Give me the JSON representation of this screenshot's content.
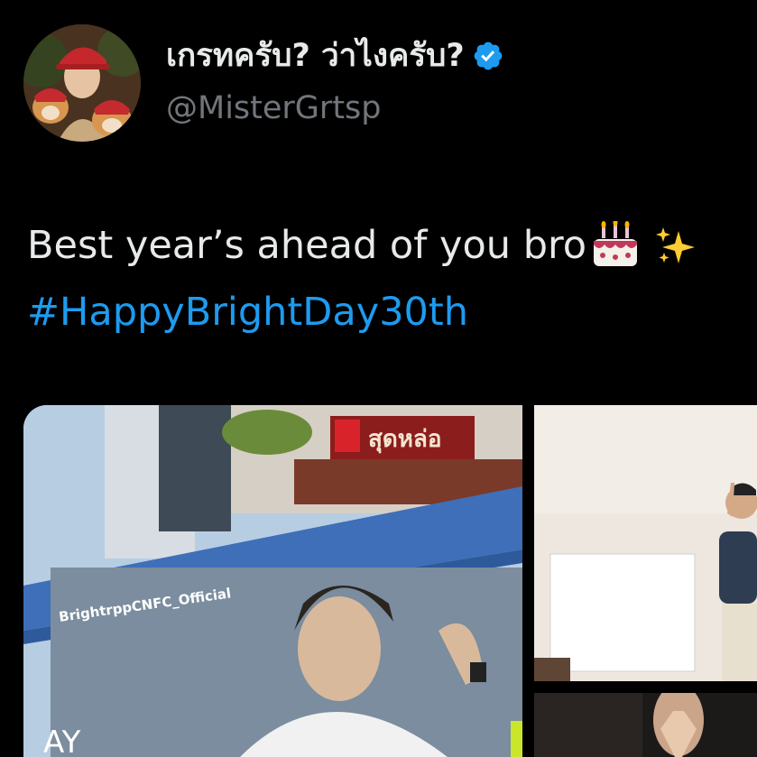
{
  "tweet": {
    "display_name": "เกรทครับ? ว่าไงครับ?",
    "handle": "@MisterGrtsp",
    "text": "Best year’s ahead of you bro",
    "hashtag": "#HappyBrightDay30th"
  },
  "media": {
    "watermark": "BrightrppCNFC_Official",
    "billboard_partial_text": "AY",
    "sign_text": "สุดหล่อ"
  },
  "colors": {
    "background": "#000000",
    "primary_text": "#e7e9ea",
    "secondary_text": "#71767b",
    "link": "#1d9bf0",
    "verified": "#1d9bf0"
  },
  "icons": {
    "verified": "verified-badge-icon",
    "cake": "birthday-cake-emoji",
    "sparkles": "sparkles-emoji"
  }
}
